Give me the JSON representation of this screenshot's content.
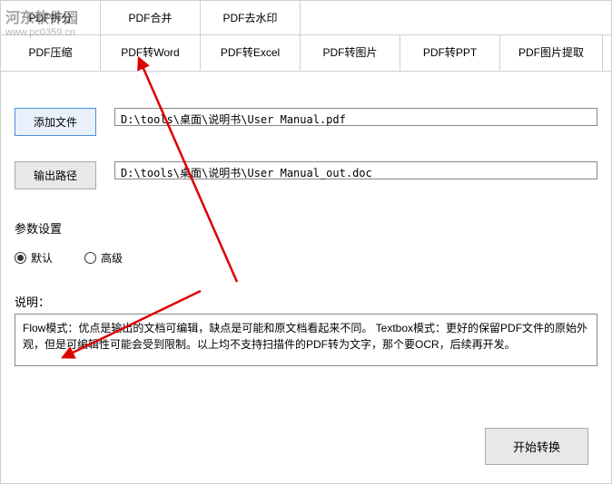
{
  "watermark": {
    "text": "河东软件园",
    "url": "www.pc0359.cn"
  },
  "tabs_row1": {
    "t0": "PDF拆分",
    "t1": "PDF合并",
    "t2": "PDF去水印"
  },
  "tabs_row2": {
    "t0": "PDF压缩",
    "t1": "PDF转Word",
    "t2": "PDF转Excel",
    "t3": "PDF转图片",
    "t4": "PDF转PPT",
    "t5": "PDF图片提取"
  },
  "buttons": {
    "add_file": "添加文件",
    "output_path": "输出路径",
    "start": "开始转换"
  },
  "inputs": {
    "source_path": "D:\\tools\\桌面\\说明书\\User Manual.pdf",
    "output_path": "D:\\tools\\桌面\\说明书\\User Manual_out.doc"
  },
  "labels": {
    "params": "参数设置",
    "desc": "说明："
  },
  "radio": {
    "default": "默认",
    "advanced": "高级"
  },
  "description": "Flow模式：优点是输出的文档可编辑，缺点是可能和原文档看起来不同。\nTextbox模式：更好的保留PDF文件的原始外观，但是可编辑性可能会受到限制。以上均不支持扫描件的PDF转为文字，那个要OCR，后续再开发。"
}
